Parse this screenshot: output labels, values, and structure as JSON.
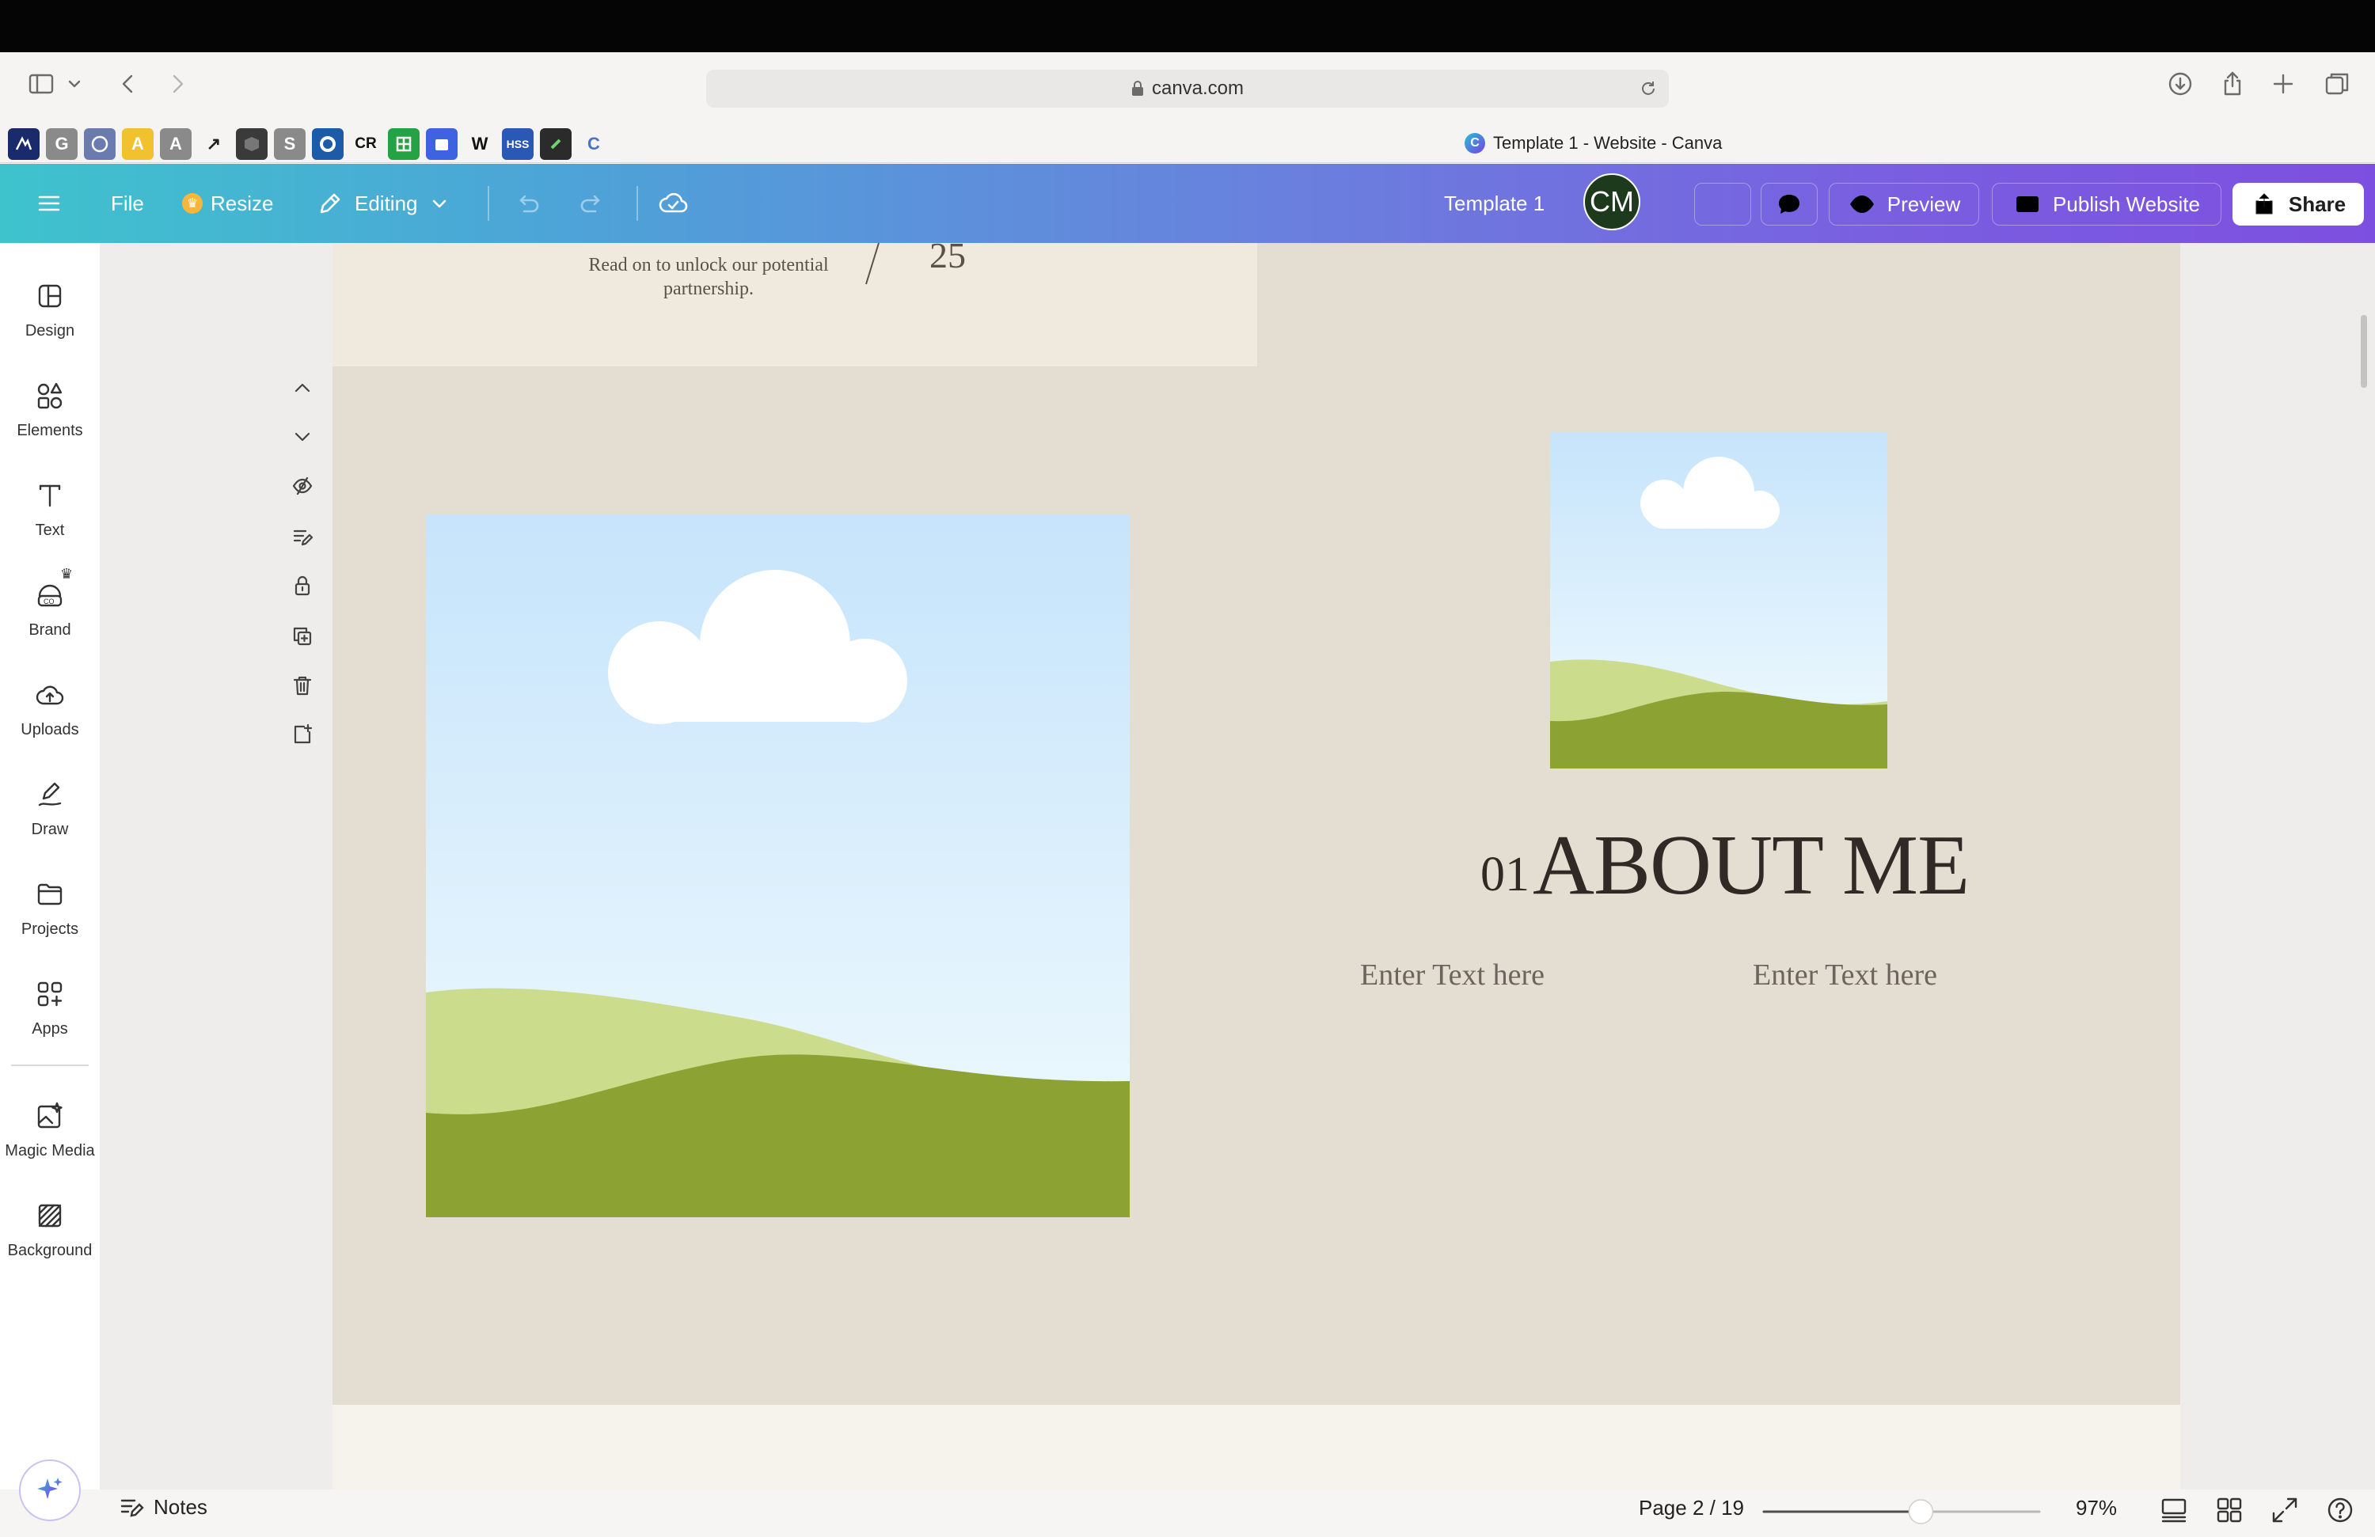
{
  "browser": {
    "url": "canva.com",
    "tab_title": "Template 1 - Website - Canva",
    "favicons": [
      "G",
      "A",
      "A",
      "S",
      "CR",
      "W",
      "HSS",
      "C"
    ]
  },
  "toolbar": {
    "file": "File",
    "resize": "Resize",
    "editing": "Editing",
    "doc_title": "Template 1",
    "avatar_initials": "CM",
    "preview": "Preview",
    "publish": "Publish Website",
    "share": "Share"
  },
  "sidebar": {
    "items": [
      {
        "label": "Design",
        "icon": "design-icon"
      },
      {
        "label": "Elements",
        "icon": "elements-icon"
      },
      {
        "label": "Text",
        "icon": "text-icon"
      },
      {
        "label": "Brand",
        "icon": "brand-icon"
      },
      {
        "label": "Uploads",
        "icon": "uploads-icon"
      },
      {
        "label": "Draw",
        "icon": "draw-icon"
      },
      {
        "label": "Projects",
        "icon": "projects-icon"
      },
      {
        "label": "Apps",
        "icon": "apps-icon"
      },
      {
        "label": "Magic Media",
        "icon": "magic-media-icon"
      },
      {
        "label": "Background",
        "icon": "background-icon"
      }
    ]
  },
  "canvas": {
    "page1_text": "Read on to unlock our potential partnership.",
    "page1_number": "25",
    "about_number": "01",
    "about_title": "ABOUT ME",
    "enter_text_left": "Enter Text here",
    "enter_text_right": "Enter Text here"
  },
  "footer": {
    "notes": "Notes",
    "page_info": "Page 2 / 19",
    "zoom": "97%",
    "zoom_level": 0.57
  },
  "colors": {
    "toolbar_gradient_start": "#3ec3cd",
    "toolbar_gradient_end": "#7d4fe0",
    "page_background": "#e4ddd1",
    "sky": "#c8e6fb",
    "hill_light": "#cbdd8c",
    "hill_dark": "#8ca232"
  }
}
